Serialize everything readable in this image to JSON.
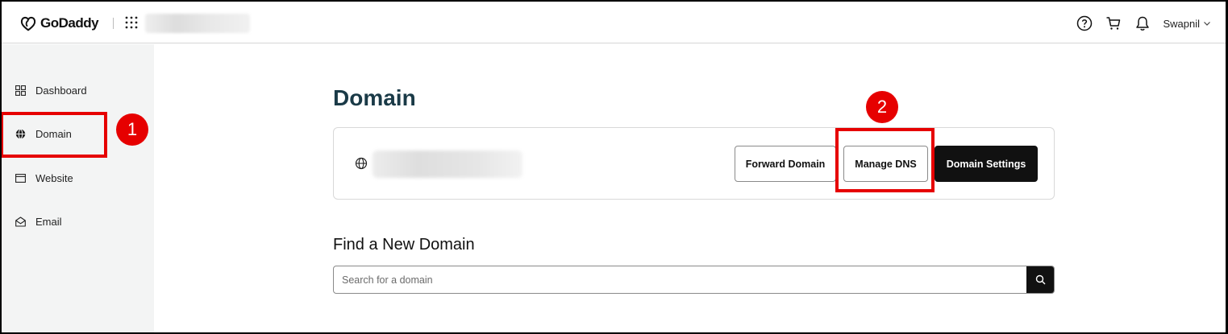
{
  "brand": {
    "name": "GoDaddy"
  },
  "header": {
    "search_placeholder": "",
    "user": {
      "name": "Swapnil"
    }
  },
  "sidebar": {
    "items": [
      {
        "label": "Dashboard",
        "icon": "grid-icon"
      },
      {
        "label": "Domain",
        "icon": "globe-icon",
        "active": true
      },
      {
        "label": "Website",
        "icon": "browser-window-icon"
      },
      {
        "label": "Email",
        "icon": "envelope-open-icon"
      }
    ]
  },
  "main": {
    "title": "Domain",
    "card": {
      "domain_name": "",
      "buttons": {
        "forward": "Forward Domain",
        "manage_dns": "Manage DNS",
        "settings": "Domain Settings"
      }
    },
    "find": {
      "title": "Find a New Domain",
      "placeholder": "Search for a domain"
    }
  },
  "annotations": [
    {
      "number": "1",
      "target": "Domain"
    },
    {
      "number": "2",
      "target": "Manage DNS"
    }
  ],
  "colors": {
    "annotation_red": "#e60000",
    "title_teal": "#1a3a47",
    "dark_button": "#111111",
    "sidebar_bg": "#f3f4f4"
  }
}
